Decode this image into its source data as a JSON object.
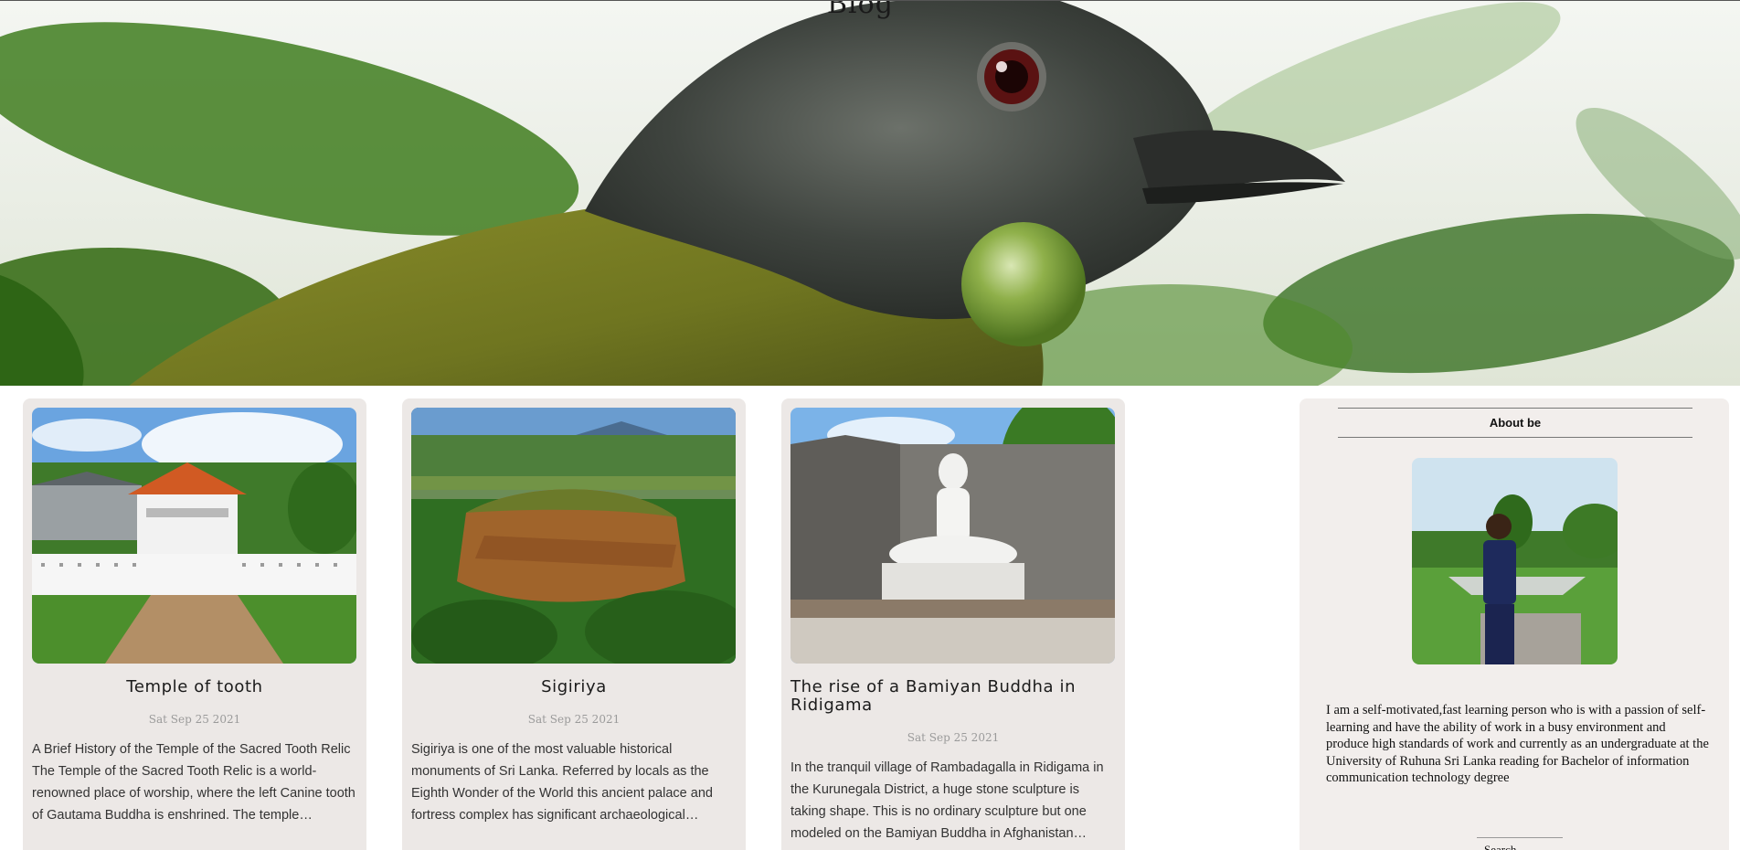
{
  "header": {
    "title": "Blog"
  },
  "posts": [
    {
      "title": "Temple of tooth",
      "date": "Sat Sep 25 2021",
      "excerpt": "A Brief History of the Temple of the Sacred Tooth Relic The Temple of the Sacred Tooth Relic is a world-renowned place of worship, where the left Canine tooth of Gautama Buddha is enshrined. The temple…"
    },
    {
      "title": "Sigiriya",
      "date": "Sat Sep 25 2021",
      "excerpt": "Sigiriya is one of the most valuable historical monuments of Sri Lanka. Referred by locals as the Eighth Wonder of the World this ancient palace and fortress complex has significant archaeological…"
    },
    {
      "title": "The rise of a Bamiyan Buddha in Ridigama",
      "date": "Sat Sep 25 2021",
      "excerpt": "In the tranquil village of Rambadagalla in Ridigama in the Kurunegala District, a huge stone sculpture is taking shape. This is no ordinary sculpture but one modeled on the Bamiyan Buddha in Afghanistan…"
    }
  ],
  "about": {
    "heading": "About be",
    "bio": "I am a self-motivated,fast learning person who is with a passion of self-learning and have the ability of work in a busy environment and produce high standards of work and currently as an undergraduate at the University of Ruhuna Sri Lanka reading for Bachelor of information communication technology degree",
    "footer": "Search"
  },
  "colors": {
    "card_bg": "#ece8e6",
    "about_bg": "#f2eeec",
    "date_text": "#9a9a9a"
  }
}
